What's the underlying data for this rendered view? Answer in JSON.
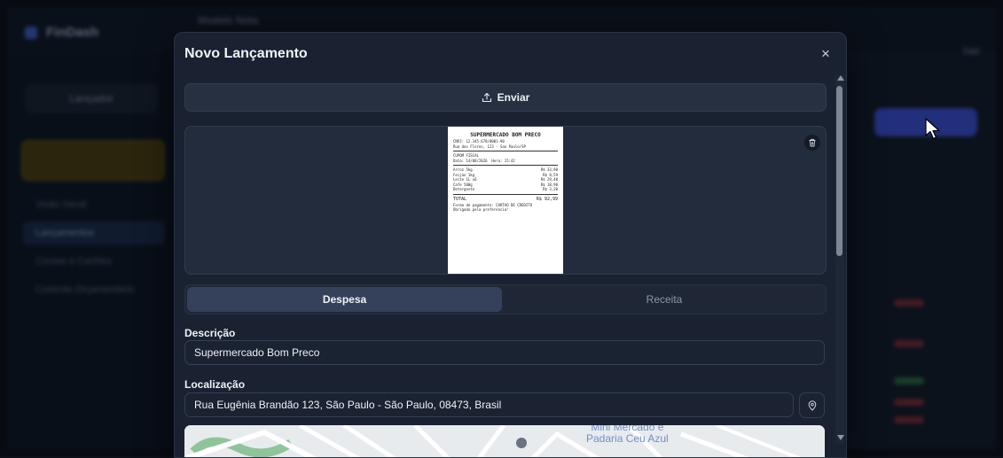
{
  "background": {
    "app_name": "FinDash",
    "breadcrumb": "Modelo Nota",
    "top_right": "Sair",
    "sidebar_pill": "Lançador",
    "sidebar_items": [
      "Visão Geral",
      "Lançamentos",
      "Contas e Cartões",
      "Controle Orçamentário"
    ]
  },
  "modal": {
    "title": "Novo Lançamento",
    "close_icon": "×",
    "upload_label": "Enviar",
    "receipt": {
      "store": "SUPERMERCADO BOM PRECO",
      "cnpj": "CNPJ: 12.345.678/0001-90",
      "address": "Rua das Flores, 123 - Sao Paulo/SP",
      "doc_type": "CUPOM FISCAL",
      "datetime": "Data: 14/08/2026  Hora: 15:42",
      "items": [
        {
          "name": "Arroz 5kg",
          "price": "R$ 33,90"
        },
        {
          "name": "Feijao 1kg",
          "price": "R$ 8,59"
        },
        {
          "name": "Leite 1L x6",
          "price": "R$ 29,40"
        },
        {
          "name": "Cafe 500g",
          "price": "R$ 18,90"
        },
        {
          "name": "Detergente",
          "price": "R$ 3,20"
        }
      ],
      "total_label": "TOTAL",
      "total_value": "R$ 92,99",
      "payment": "Forma de pagamento: CARTAO DE CREDITO",
      "thanks": "Obrigado pela preferencia!"
    },
    "type_toggle": {
      "expense": "Despesa",
      "income": "Receita",
      "selected": "Despesa"
    },
    "description_label": "Descrição",
    "description_value": "Supermercado Bom Preco",
    "location_label": "Localização",
    "location_value": "Rua Eugênia Brandão 123, São Paulo - São Paulo, 08473, Brasil",
    "map_label": "Mini Mercado e\nPadaria Ceu Azul"
  },
  "colors": {
    "accent": "#3b4fd6",
    "modal_bg": "#1a2130",
    "toggle_active": "#35415a"
  },
  "icons": [
    "upload-icon",
    "trash-icon",
    "close-icon",
    "map-pin-icon",
    "cursor-icon"
  ]
}
